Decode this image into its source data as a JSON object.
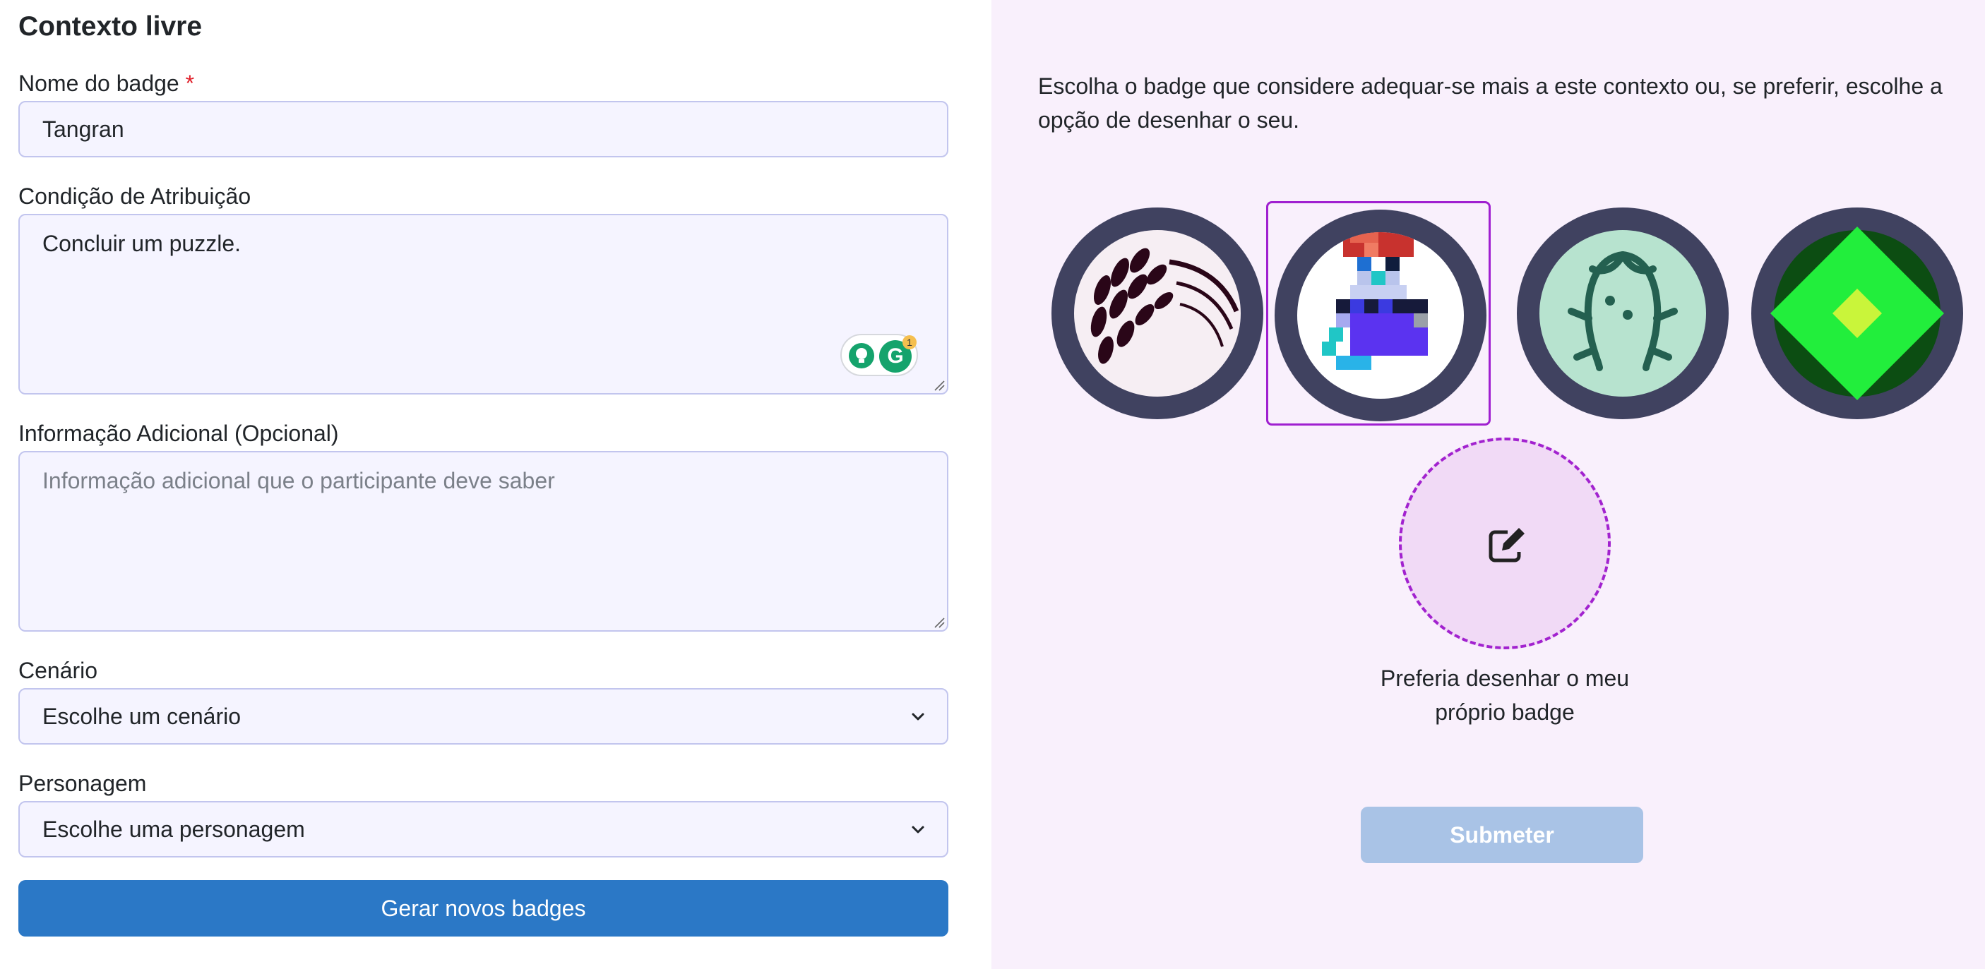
{
  "form": {
    "title": "Contexto livre",
    "badge_name_label": "Nome do badge",
    "required_mark": "*",
    "badge_name_value": "Tangran",
    "condition_label": "Condição de Atribuição",
    "condition_value": "Concluir um puzzle.",
    "extra_info_label": "Informação Adicional (Opcional)",
    "extra_info_placeholder": "Informação adicional que o participante deve saber",
    "scenario_label": "Cenário",
    "scenario_selected": "Escolhe um cenário",
    "character_label": "Personagem",
    "character_selected": "Escolhe uma personagem",
    "generate_button": "Gerar novos badges",
    "grammarly_count": "1"
  },
  "panel": {
    "instructions": "Escolha o badge que considere adequar-se mais a este contexto ou, se preferir, escolhe a opção de desenhar o seu.",
    "badges": [
      {
        "name": "feather-badge",
        "selected": false
      },
      {
        "name": "pixel-character-badge",
        "selected": true
      },
      {
        "name": "creature-face-badge",
        "selected": false
      },
      {
        "name": "green-diamond-badge",
        "selected": false
      }
    ],
    "draw_own_label": "Preferia desenhar o meu próprio badge",
    "submit_button": "Submeter"
  },
  "colors": {
    "primary": "#2b78c6",
    "selected_border": "#a020d0",
    "panel_bg": "#f9f0fc",
    "submit_disabled": "#a9c3e6"
  }
}
